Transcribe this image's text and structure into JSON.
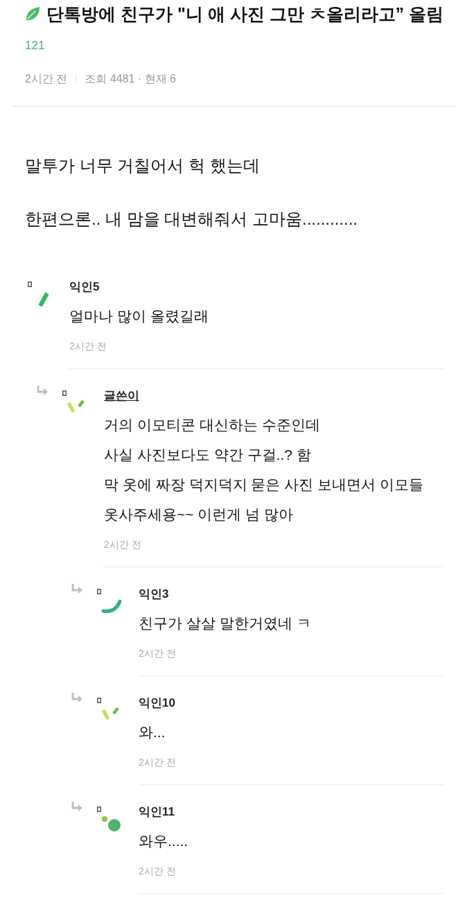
{
  "post": {
    "title": "단톡방에 친구가 \"니 애 사진 그만 ㅊ올리라고” 올림",
    "comment_count": "121",
    "time": "2시간 전",
    "stats": "조회 4481 · 현재 6",
    "body": [
      "말투가 너무 거칠어서 헉 했는데",
      "한편으론.. 내 맘을 대변해줘서 고마움............"
    ]
  },
  "comments": [
    {
      "author": "익인5",
      "is_writer": false,
      "avatar": {
        "kind": "bar"
      },
      "text": "얼마나 많이 올렸길래",
      "time": "2시간 전",
      "children": [
        {
          "author": "글쓴이",
          "is_writer": true,
          "avatar": {
            "kind": "ticks"
          },
          "text": "거의 이모티콘 대신하는 수준인데\n사실 사진보다도 약간 구걸..? 함\n막 옷에 짜장 덕지덕지 묻은 사진 보내면서 이모들\n옷사주세용~~ 이런게 넘 많아",
          "time": "2시간 전",
          "children": [
            {
              "author": "익인3",
              "is_writer": false,
              "avatar": {
                "kind": "arc"
              },
              "text": "친구가 살살 말한거였네 ㅋ",
              "time": "2시간 전"
            },
            {
              "author": "익인10",
              "is_writer": false,
              "avatar": {
                "kind": "ticks"
              },
              "text": "와...",
              "time": "2시간 전"
            },
            {
              "author": "익인11",
              "is_writer": false,
              "avatar": {
                "kind": "dots"
              },
              "text": "와우.....",
              "time": "2시간 전"
            }
          ]
        }
      ]
    }
  ]
}
